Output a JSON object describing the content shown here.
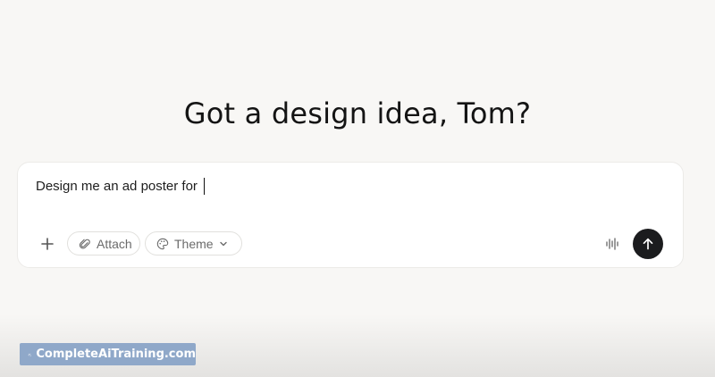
{
  "headline": "Got a design idea, Tom?",
  "composer": {
    "input_value": "Design me an ad poster for ",
    "buttons": {
      "add_icon": "plus-icon",
      "attach_label": "Attach",
      "attach_icon": "paperclip-icon",
      "theme_label": "Theme",
      "theme_icon": "palette-icon",
      "voice_icon": "waveform-icon",
      "send_icon": "arrow-up-icon"
    }
  },
  "watermark": {
    "text": "CompleteAiTraining.com"
  },
  "colors": {
    "background": "#f8f7f5",
    "send_button": "#1b1c1e",
    "watermark_bg": "#8fa8c9"
  }
}
